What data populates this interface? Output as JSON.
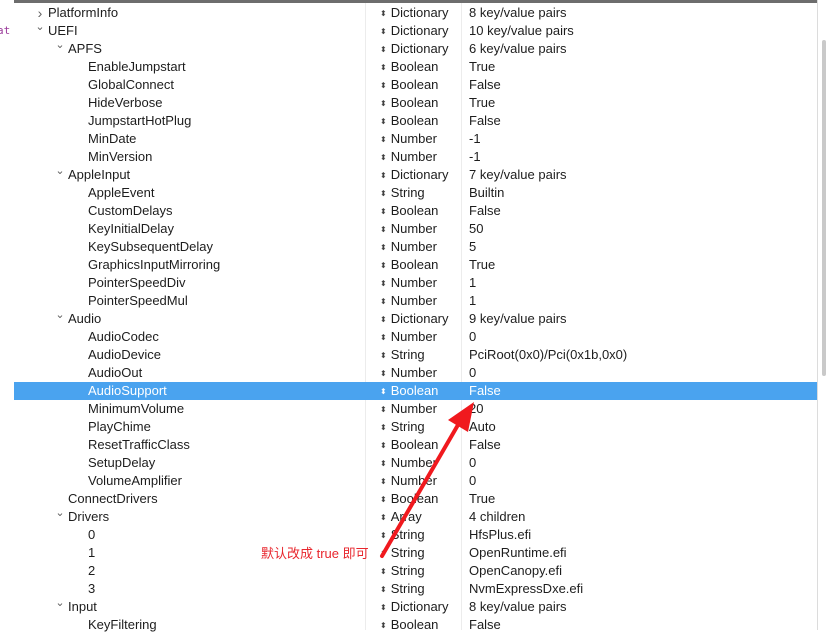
{
  "gutter_text": "at",
  "annotation_text": "默认改成 true 即可",
  "colors": {
    "selection": "#4aa3ef",
    "annotation": "#e8262d"
  },
  "rows": [
    {
      "key": "PlatformInfo",
      "level": 1,
      "disclosure": "collapsed",
      "type": "Dictionary",
      "value": "8 key/value pairs"
    },
    {
      "key": "UEFI",
      "level": 1,
      "disclosure": "expanded",
      "type": "Dictionary",
      "value": "10 key/value pairs"
    },
    {
      "key": "APFS",
      "level": 2,
      "disclosure": "expanded",
      "type": "Dictionary",
      "value": "6 key/value pairs"
    },
    {
      "key": "EnableJumpstart",
      "level": 3,
      "disclosure": "",
      "type": "Boolean",
      "value": "True"
    },
    {
      "key": "GlobalConnect",
      "level": 3,
      "disclosure": "",
      "type": "Boolean",
      "value": "False"
    },
    {
      "key": "HideVerbose",
      "level": 3,
      "disclosure": "",
      "type": "Boolean",
      "value": "True"
    },
    {
      "key": "JumpstartHotPlug",
      "level": 3,
      "disclosure": "",
      "type": "Boolean",
      "value": "False"
    },
    {
      "key": "MinDate",
      "level": 3,
      "disclosure": "",
      "type": "Number",
      "value": "-1"
    },
    {
      "key": "MinVersion",
      "level": 3,
      "disclosure": "",
      "type": "Number",
      "value": "-1"
    },
    {
      "key": "AppleInput",
      "level": 2,
      "disclosure": "expanded",
      "type": "Dictionary",
      "value": "7 key/value pairs"
    },
    {
      "key": "AppleEvent",
      "level": 3,
      "disclosure": "",
      "type": "String",
      "value": "Builtin"
    },
    {
      "key": "CustomDelays",
      "level": 3,
      "disclosure": "",
      "type": "Boolean",
      "value": "False"
    },
    {
      "key": "KeyInitialDelay",
      "level": 3,
      "disclosure": "",
      "type": "Number",
      "value": "50"
    },
    {
      "key": "KeySubsequentDelay",
      "level": 3,
      "disclosure": "",
      "type": "Number",
      "value": "5"
    },
    {
      "key": "GraphicsInputMirroring",
      "level": 3,
      "disclosure": "",
      "type": "Boolean",
      "value": "True"
    },
    {
      "key": "PointerSpeedDiv",
      "level": 3,
      "disclosure": "",
      "type": "Number",
      "value": "1"
    },
    {
      "key": "PointerSpeedMul",
      "level": 3,
      "disclosure": "",
      "type": "Number",
      "value": "1"
    },
    {
      "key": "Audio",
      "level": 2,
      "disclosure": "expanded",
      "type": "Dictionary",
      "value": "9 key/value pairs"
    },
    {
      "key": "AudioCodec",
      "level": 3,
      "disclosure": "",
      "type": "Number",
      "value": "0"
    },
    {
      "key": "AudioDevice",
      "level": 3,
      "disclosure": "",
      "type": "String",
      "value": "PciRoot(0x0)/Pci(0x1b,0x0)"
    },
    {
      "key": "AudioOut",
      "level": 3,
      "disclosure": "",
      "type": "Number",
      "value": "0"
    },
    {
      "key": "AudioSupport",
      "level": 3,
      "disclosure": "",
      "type": "Boolean",
      "value": "False",
      "selected": true
    },
    {
      "key": "MinimumVolume",
      "level": 3,
      "disclosure": "",
      "type": "Number",
      "value": "20"
    },
    {
      "key": "PlayChime",
      "level": 3,
      "disclosure": "",
      "type": "String",
      "value": "Auto"
    },
    {
      "key": "ResetTrafficClass",
      "level": 3,
      "disclosure": "",
      "type": "Boolean",
      "value": "False"
    },
    {
      "key": "SetupDelay",
      "level": 3,
      "disclosure": "",
      "type": "Number",
      "value": "0"
    },
    {
      "key": "VolumeAmplifier",
      "level": 3,
      "disclosure": "",
      "type": "Number",
      "value": "0"
    },
    {
      "key": "ConnectDrivers",
      "level": 2,
      "disclosure": "",
      "type": "Boolean",
      "value": "True"
    },
    {
      "key": "Drivers",
      "level": 2,
      "disclosure": "expanded",
      "type": "Array",
      "value": "4 children"
    },
    {
      "key": "0",
      "level": 3,
      "disclosure": "",
      "type": "String",
      "value": "HfsPlus.efi"
    },
    {
      "key": "1",
      "level": 3,
      "disclosure": "",
      "type": "String",
      "value": "OpenRuntime.efi"
    },
    {
      "key": "2",
      "level": 3,
      "disclosure": "",
      "type": "String",
      "value": "OpenCanopy.efi"
    },
    {
      "key": "3",
      "level": 3,
      "disclosure": "",
      "type": "String",
      "value": "NvmExpressDxe.efi"
    },
    {
      "key": "Input",
      "level": 2,
      "disclosure": "expanded",
      "type": "Dictionary",
      "value": "8 key/value pairs"
    },
    {
      "key": "KeyFiltering",
      "level": 3,
      "disclosure": "",
      "type": "Boolean",
      "value": "False"
    }
  ]
}
